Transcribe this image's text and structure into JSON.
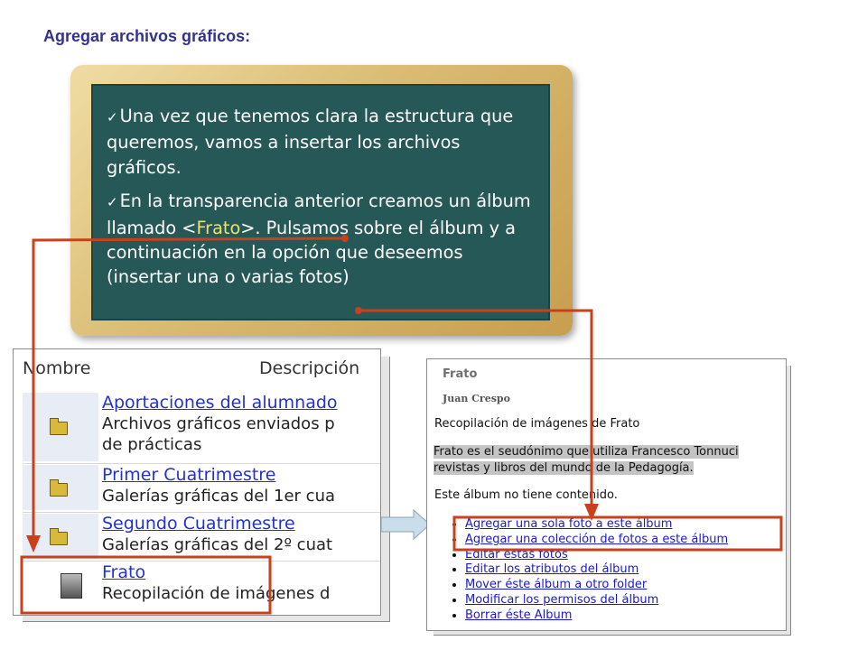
{
  "slide": {
    "title": "Agregar archivos gráficos:"
  },
  "board": {
    "bullet1": "Una vez que tenemos clara la estructura que queremos, vamos a insertar los archivos gráficos.",
    "bullet2_before": "En la transparencia anterior creamos un álbum llamado ",
    "bullet2_highlight_open": "<",
    "bullet2_highlight": "Frato",
    "bullet2_highlight_close": ">",
    "bullet2_after": ". Pulsamos sobre el álbum y a continuación en la opción que deseemos (insertar una o varias fotos)"
  },
  "album_list": {
    "header_name": "Nombre",
    "header_description": "Descripción",
    "rows": [
      {
        "icon": "folder-icon",
        "name": "Aportaciones del alumnado",
        "desc_line1": "Archivos gráficos enviados p",
        "desc_line2": "de prácticas"
      },
      {
        "icon": "folder-icon",
        "name": "Primer Cuatrimestre",
        "desc_line1": "Galerías gráficas del 1er cua"
      },
      {
        "icon": "folder-icon",
        "name": "Segundo Cuatrimestre",
        "desc_line1": "Galerías gráficas del 2º cuat"
      },
      {
        "icon": "photo-icon",
        "name": "Frato",
        "desc_line1": "Recopilación de imágenes d"
      }
    ]
  },
  "album_detail": {
    "title": "Frato",
    "author": "Juan Crespo",
    "caption": "Recopilación de imágenes de Frato",
    "description_line1": "Frato es el seudónimo que utiliza Francesco Tonnuci",
    "description_line2": "revistas y libros del mundo de la Pedagogía.",
    "empty_message": "Este álbum no tiene contenido.",
    "actions": [
      "Agregar una sola foto a este álbum",
      "Agregar una colección de fotos a este álbum",
      "Editar estas fotos",
      "Editar los atributos del álbum",
      "Mover éste álbum a otro folder",
      "Modificar los permisos del álbum",
      "Borrar éste Album"
    ]
  },
  "colors": {
    "title": "#33338a",
    "board": "#275858",
    "frame": "#d9bb72",
    "highlight": "#eee06a",
    "annotation": "#c8401c",
    "link": "#1a1acc"
  }
}
